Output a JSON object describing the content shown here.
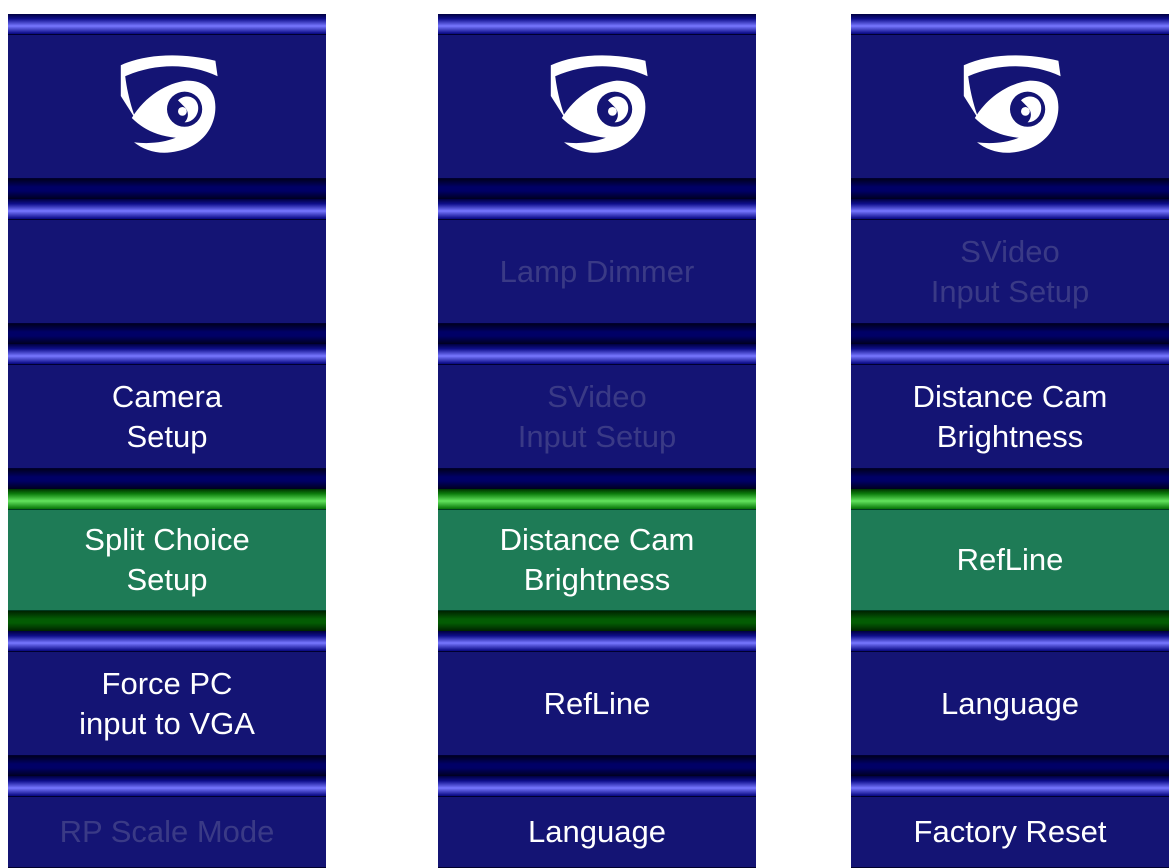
{
  "colors": {
    "tile": "#141474",
    "tile_selected": "#1e7b56",
    "bar_blue": "#7777ff",
    "bar_green": "#63e35e",
    "text_enabled": "#ffffff",
    "text_disabled": "#3a3a86"
  },
  "logo_icon": "eye-logo-icon",
  "panels": [
    {
      "name": "left",
      "items": [
        {
          "label": "",
          "state": "empty"
        },
        {
          "label": "Camera\nSetup",
          "state": "enabled"
        },
        {
          "label": "Split Choice\nSetup",
          "state": "selected"
        },
        {
          "label": "Force PC\ninput to VGA",
          "state": "enabled"
        },
        {
          "label": "RP Scale Mode",
          "state": "disabled"
        }
      ]
    },
    {
      "name": "middle",
      "items": [
        {
          "label": "Lamp Dimmer",
          "state": "disabled"
        },
        {
          "label": "SVideo\nInput Setup",
          "state": "disabled"
        },
        {
          "label": "Distance Cam\nBrightness",
          "state": "selected"
        },
        {
          "label": "RefLine",
          "state": "enabled"
        },
        {
          "label": "Language",
          "state": "enabled"
        }
      ]
    },
    {
      "name": "right",
      "items": [
        {
          "label": "SVideo\nInput Setup",
          "state": "disabled"
        },
        {
          "label": "Distance Cam\nBrightness",
          "state": "enabled"
        },
        {
          "label": "RefLine",
          "state": "selected"
        },
        {
          "label": "Language",
          "state": "enabled"
        },
        {
          "label": "Factory Reset",
          "state": "enabled"
        }
      ]
    }
  ]
}
